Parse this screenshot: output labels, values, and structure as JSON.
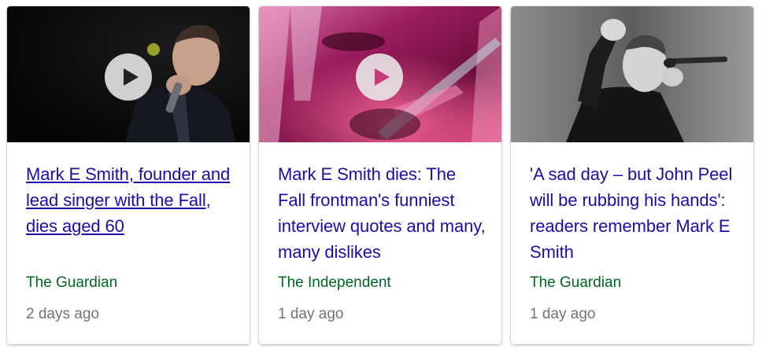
{
  "cards": [
    {
      "headline": "Mark E Smith, founder and lead singer with the Fall, dies aged 60",
      "source": "The Guardian",
      "age": "2 days ago",
      "has_video": true,
      "thumbnail": "photo of singer holding microphone on dark stage"
    },
    {
      "headline": "Mark E Smith dies: The Fall frontman's funniest interview quotes and many, many dislikes",
      "source": "The Independent",
      "age": "1 day ago",
      "has_video": true,
      "thumbnail": "pink-tinted concert photo with guitar"
    },
    {
      "headline": "'A sad day – but John Peel will be rubbing his hands': readers remember Mark E Smith",
      "source": "The Guardian",
      "age": "1 day ago",
      "has_video": false,
      "thumbnail": "black and white photo of singer with microphone"
    }
  ],
  "colors": {
    "headline": "#1a0dab",
    "source": "#006621",
    "age": "#70757a"
  },
  "icons": {
    "play": "play-icon"
  }
}
